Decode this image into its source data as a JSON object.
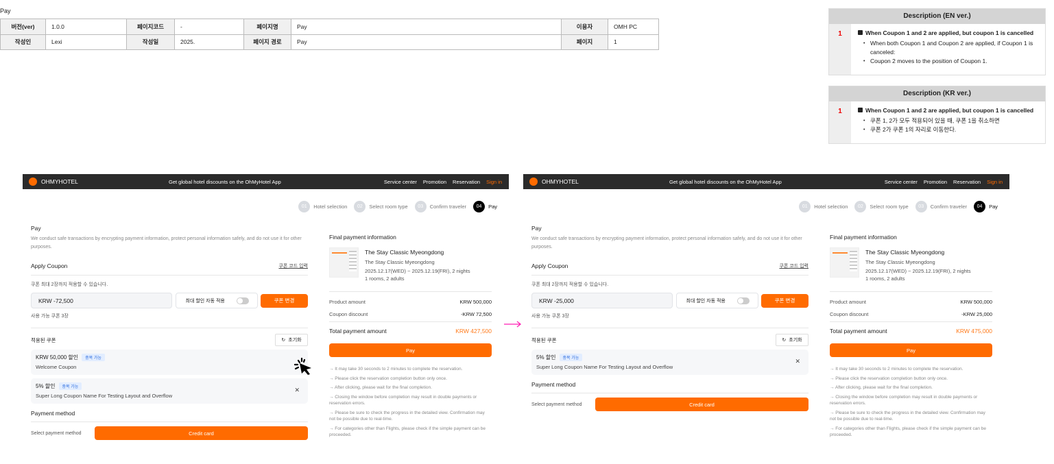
{
  "page_label": "Pay",
  "meta": {
    "rows": [
      [
        {
          "l": "버전(ver)"
        },
        {
          "v": "1.0.0"
        },
        {
          "l": "페이지코드"
        },
        {
          "v": "-"
        },
        {
          "l": "페이지명"
        },
        {
          "v": "Pay"
        },
        {
          "l": "이용자"
        },
        {
          "v": "OMH PC"
        }
      ],
      [
        {
          "l": "작성인"
        },
        {
          "v": "Lexi"
        },
        {
          "l": "작성일"
        },
        {
          "v": "2025."
        },
        {
          "l": "페이지 경로"
        },
        {
          "v": "Pay"
        },
        {
          "l": "페이지"
        },
        {
          "v": "1"
        }
      ]
    ]
  },
  "descriptions": [
    {
      "header": "Description (EN ver.)",
      "num": "1",
      "title": "When Coupon 1 and 2 are applied, but coupon 1 is cancelled",
      "bullets": [
        "When both Coupon 1 and Coupon 2 are applied, if Coupon 1 is canceled:",
        "Coupon 2 moves to the position of Coupon 1."
      ]
    },
    {
      "header": "Description (KR ver.)",
      "num": "1",
      "title": "When Coupon 1 and 2 are applied, but coupon 1 is cancelled",
      "bullets": [
        "쿠폰 1, 2가 모두 적용되어 있을 때, 쿠폰 1을 취소하면",
        "쿠폰 2가 쿠폰 1의 자리로 이동한다."
      ]
    }
  ],
  "common": {
    "logo": "OHMYHOTEL",
    "promo": "Get global hotel discounts on the OhMyHotel App",
    "nav_links": [
      "Service center",
      "Promotion",
      "Reservation"
    ],
    "sign_in": "Sign in",
    "steps": [
      {
        "n": "01",
        "label": "Hotel selection"
      },
      {
        "n": "02",
        "label": "Select room type"
      },
      {
        "n": "03",
        "label": "Confirm traveler"
      },
      {
        "n": "04",
        "label": "Pay",
        "active": true
      }
    ],
    "pay_title": "Pay",
    "pay_desc": "We conduct safe transactions by encrypting payment information, protect personal information safely, and do not use it for other purposes.",
    "apply_coupon": "Apply Coupon",
    "coupon_code_link": "쿠폰 코드 입력",
    "coupon_info": "쿠폰 최대 2장까지 적용할 수 있습니다.",
    "auto_apply": "최대 할인 자동 적용",
    "change_coupon": "쿠폰 변경",
    "available": "사용 가능 쿠폰 3장",
    "applied_title": "적용된 쿠폰",
    "reset": "초기화",
    "payment_method": "Payment method",
    "select_payment": "Select payment method",
    "credit_card": "Credit card",
    "final_title": "Final payment information",
    "hotel_name": "The Stay Classic Myeongdong",
    "hotel_sub": "The Stay Classic Myeongdong",
    "dates": "2025.12.17(WED) ~ 2025.12.19(FRI), 2 nights",
    "rooms": "1 rooms, 2 adults",
    "product_label": "Product amount",
    "product_amount": "KRW 500,000",
    "coupon_label": "Coupon discount",
    "total_label": "Total payment amount",
    "pay_button": "Pay",
    "notes": [
      "→ It may take 30 seconds to 2 minutes to complete the reservation.",
      "→ Please click the reservation completion button only once.",
      "→ After clicking, please wait for the final completion.",
      "→ Closing the window before completion may result in double payments or reservation errors.",
      "→ Please be sure to check the progress in the detailed view. Confirmation may not be possible due to real-time.",
      "→ For categories other than Flights, please check if the simple payment can be proceeded."
    ]
  },
  "screens": [
    {
      "coupon_input": "KRW -72,500",
      "coupon_discount": "-KRW 72,500",
      "total": "KRW 427,500",
      "coupons": [
        {
          "amount": "KRW 50,000 할인",
          "badge": "중복 가능",
          "name": "Welcome Coupon",
          "cursor": true
        },
        {
          "amount": "5% 할인",
          "badge": "중복 가능",
          "name": "Super Long Coupon Name For Testing Layout and Overflow"
        }
      ]
    },
    {
      "coupon_input": "KRW -25,000",
      "coupon_discount": "-KRW 25,000",
      "total": "KRW 475,000",
      "coupons": [
        {
          "amount": "5% 할인",
          "badge": "중복 가능",
          "name": "Super Long Coupon Name For Testing Layout and Overflow"
        }
      ]
    }
  ],
  "colors": {
    "accent": "#ff6b00",
    "arrow": "#ff1fb4"
  }
}
